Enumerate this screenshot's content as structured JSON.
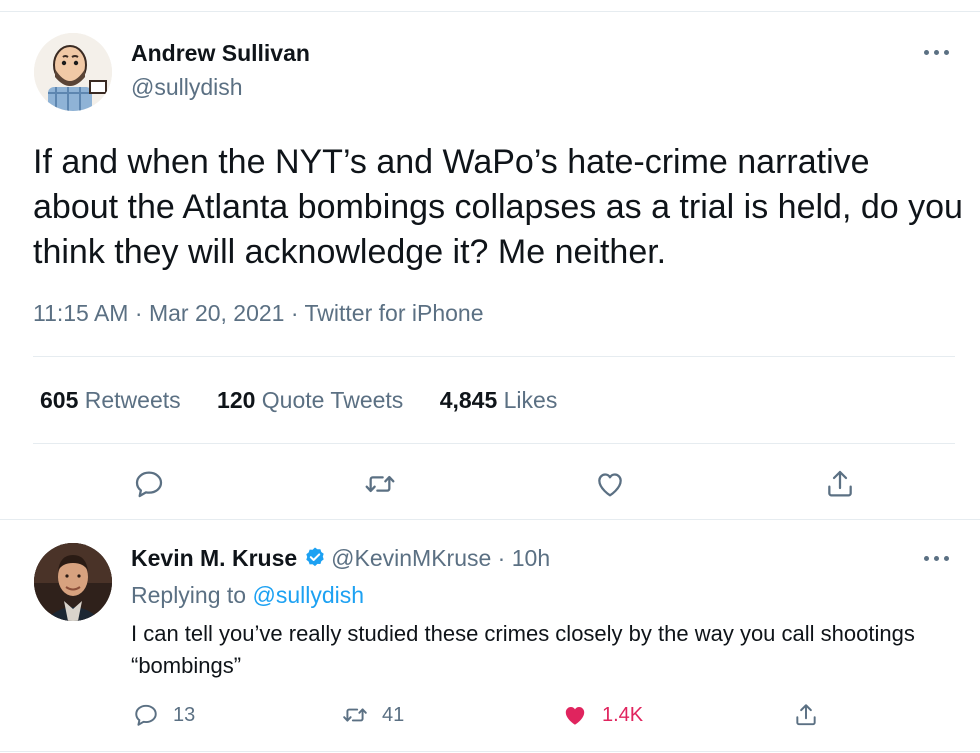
{
  "main_tweet": {
    "author_name": "Andrew Sullivan",
    "author_handle": "@sullydish",
    "text": "If and when the NYT’s and WaPo’s hate-crime narrative about the Atlanta bombings collapses as a trial is held, do you think they will acknowledge it? Me neither.",
    "time": "11:15 AM",
    "date": "Mar 20, 2021",
    "source": "Twitter for iPhone",
    "separator": "·",
    "stats": {
      "retweets_count": "605",
      "retweets_label": "Retweets",
      "quotes_count": "120",
      "quotes_label": "Quote Tweets",
      "likes_count": "4,845",
      "likes_label": "Likes"
    }
  },
  "reply_tweet": {
    "author_name": "Kevin M. Kruse",
    "author_handle": "@KevinMKruse",
    "separator": "·",
    "time_ago": "10h",
    "replying_prefix": "Replying to",
    "replying_to": "@sullydish",
    "text": "I can tell you’ve really studied these crimes closely by the way you call shootings “bombings”",
    "replies": "13",
    "retweets": "41",
    "likes": "1.4K"
  },
  "colors": {
    "primary_text": "#0f1419",
    "secondary_text": "#5b7083",
    "accent": "#1da1f2",
    "like": "#e0245e",
    "divider": "#e6ecf0"
  },
  "icons": [
    "more-icon",
    "reply-icon",
    "retweet-icon",
    "like-icon",
    "share-icon",
    "verified-icon"
  ]
}
